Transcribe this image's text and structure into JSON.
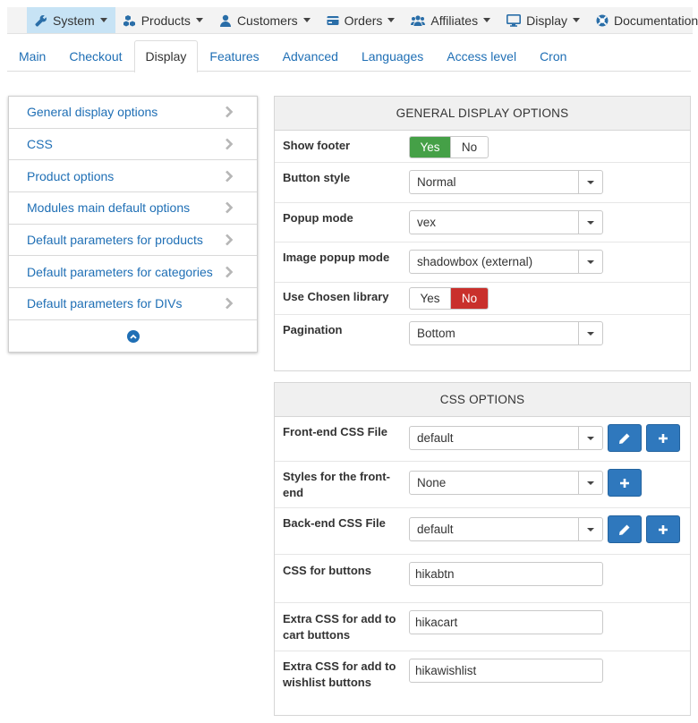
{
  "topmenu": {
    "items": [
      {
        "label": "System",
        "icon": "wrench-icon"
      },
      {
        "label": "Products",
        "icon": "cubes-icon"
      },
      {
        "label": "Customers",
        "icon": "user-icon"
      },
      {
        "label": "Orders",
        "icon": "credit-card-icon"
      },
      {
        "label": "Affiliates",
        "icon": "users-icon"
      },
      {
        "label": "Display",
        "icon": "desktop-icon"
      },
      {
        "label": "Documentation",
        "icon": "support-icon"
      }
    ]
  },
  "tabs": [
    "Main",
    "Checkout",
    "Display",
    "Features",
    "Advanced",
    "Languages",
    "Access level",
    "Cron"
  ],
  "leftnav": {
    "items": [
      "General display options",
      "CSS",
      "Product options",
      "Modules main default options",
      "Default parameters for products",
      "Default parameters for categories",
      "Default parameters for DIVs"
    ]
  },
  "general": {
    "title": "GENERAL DISPLAY OPTIONS",
    "show_footer": {
      "label": "Show footer",
      "yes": "Yes",
      "no": "No",
      "selected": "Yes"
    },
    "button_style": {
      "label": "Button style",
      "value": "Normal"
    },
    "popup_mode": {
      "label": "Popup mode",
      "value": "vex"
    },
    "image_popup_mode": {
      "label": "Image popup mode",
      "value": "shadowbox (external)"
    },
    "use_chosen": {
      "label": "Use Chosen library",
      "yes": "Yes",
      "no": "No",
      "selected": "No"
    },
    "pagination": {
      "label": "Pagination",
      "value": "Bottom"
    }
  },
  "css": {
    "title": "CSS OPTIONS",
    "frontend_file": {
      "label": "Front-end CSS File",
      "value": "default"
    },
    "styles_frontend": {
      "label": "Styles for the front-end",
      "value": "None"
    },
    "backend_file": {
      "label": "Back-end CSS File",
      "value": "default"
    },
    "css_buttons": {
      "label": "CSS for buttons",
      "value": "hikabtn"
    },
    "extra_cart": {
      "label": "Extra CSS for add to cart buttons",
      "value": "hikacart"
    },
    "extra_wishlist": {
      "label": "Extra CSS for add to wishlist buttons",
      "value": "hikawishlist"
    }
  },
  "colors": {
    "accent": "#1f6fb5",
    "yes_on": "#45a047",
    "no_on": "#c9302c",
    "menu_active": "#c7e3f5"
  }
}
